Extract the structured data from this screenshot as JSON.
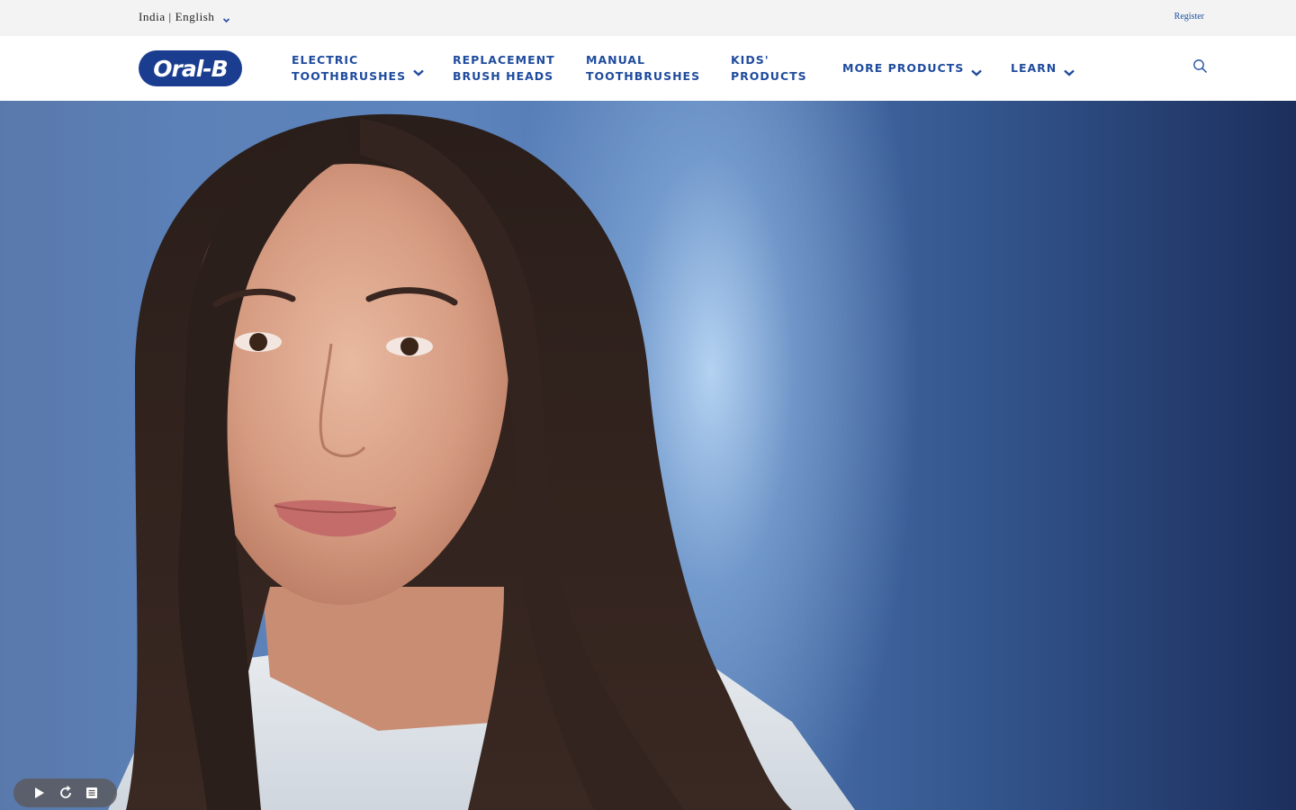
{
  "utility": {
    "locale_label": "India | English",
    "register_label": "Register"
  },
  "brand": {
    "logo_text": "Oral-B",
    "color": "#1b3d8f"
  },
  "nav": {
    "items": [
      {
        "label": "Electric\nToothbrushes",
        "has_dropdown": true
      },
      {
        "label": "Replacement\nBrush Heads",
        "has_dropdown": false
      },
      {
        "label": "Manual\nToothbrushes",
        "has_dropdown": false
      },
      {
        "label": "Kids'\nProducts",
        "has_dropdown": false
      },
      {
        "label": "More Products",
        "has_dropdown": true
      },
      {
        "label": "Learn",
        "has_dropdown": true
      }
    ],
    "accent": "#1f4b9e"
  },
  "hero": {
    "icon": "hero-video"
  },
  "video_controls": {
    "icons": [
      "play-icon",
      "replay-icon",
      "transcript-icon"
    ]
  }
}
